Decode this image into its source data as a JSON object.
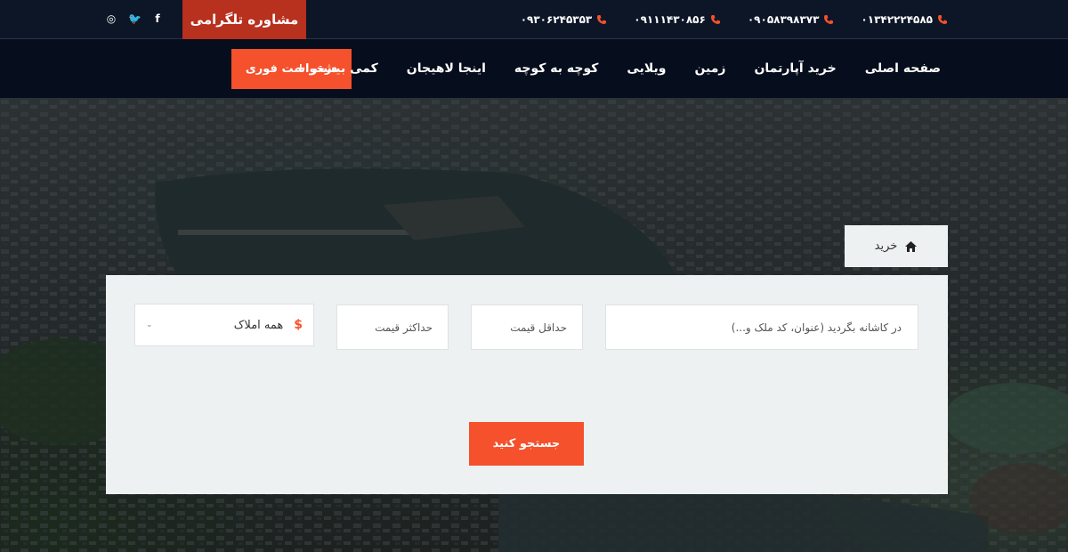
{
  "topbar": {
    "consult_label": "مشاوره تلگرامی",
    "social": [
      {
        "icon": "instagram-icon",
        "glyph": "◎"
      },
      {
        "icon": "twitter-icon",
        "glyph": "🐦"
      },
      {
        "icon": "facebook-icon",
        "glyph": "f"
      }
    ],
    "phones": [
      "۰۱۳۴۲۲۲۴۵۸۵",
      "۰۹۰۵۸۳۹۸۳۷۳",
      "۰۹۱۱۱۴۳۰۸۵۶",
      "۰۹۳۰۶۲۴۵۳۵۳"
    ]
  },
  "nav": {
    "items": [
      "صفحه اصلی",
      "خرید آپارتمان",
      "زمین",
      "ویلایی",
      "کوچه به کوچه",
      "اینجا لاهیجان",
      "کمی بیشتر +"
    ],
    "request_label": "درخواست فوری"
  },
  "breadcrumb": {
    "label": "خرید"
  },
  "search": {
    "keyword_placeholder": "در کاشانه بگردید (عنوان، کد ملک و...)",
    "min_price_placeholder": "حداقل قیمت",
    "max_price_placeholder": "حداکثر قیمت",
    "type_value": "همه املاک",
    "type_icon": "$",
    "dropdown_glyph": "⌄",
    "button_label": "جستجو کنید"
  },
  "colors": {
    "accent": "#f4512c",
    "consult_bg": "#b8301e",
    "topbar_bg": "#0c1627",
    "navbar_bg": "#060d1d",
    "panel_bg": "#eef1f1"
  }
}
